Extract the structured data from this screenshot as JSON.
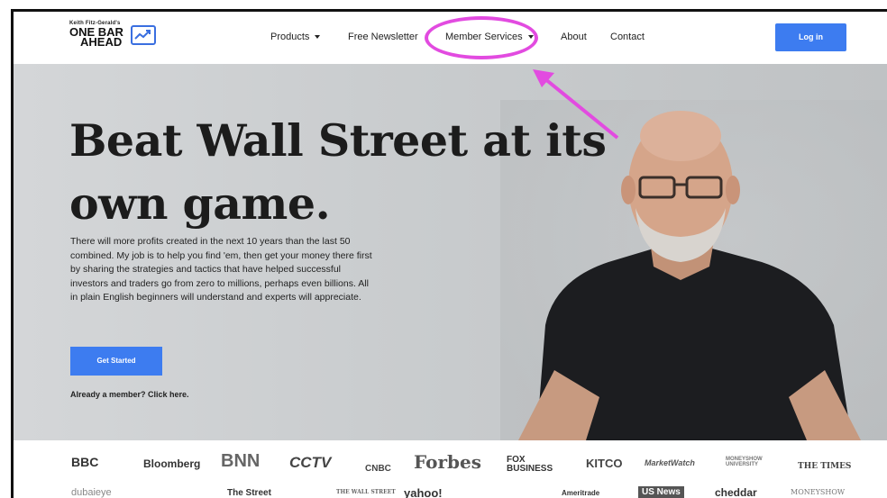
{
  "nav": {
    "logo_small": "Keith Fitz-Gerald's",
    "logo_line1": "ONE BAR",
    "logo_line2": "AHEAD",
    "items": [
      {
        "label": "Products"
      },
      {
        "label": "Free Newsletter"
      },
      {
        "label": "Member Services"
      },
      {
        "label": "About"
      },
      {
        "label": "Contact"
      }
    ],
    "login": "Log in"
  },
  "hero": {
    "headline_1": "Beat Wall Street at its",
    "headline_2": "own game.",
    "paragraph": "There will more profits created in the next 10 years than the last 50 combined. My job is to help you find 'em, then get your money there first by sharing the strategies and tactics that have helped successful investors and traders go from zero to millions, perhaps even billions. All in plain English beginners will understand and experts will appreciate.",
    "cta": "Get Started",
    "member_link": "Already a member? Click here."
  },
  "press_row1": [
    "BBC",
    "Bloomberg",
    "BNN",
    "CCTV",
    "CNBC",
    "Forbes",
    "FOX BUSINESS",
    "KITCO",
    "MarketWatch",
    "MONEYSHOW UNIVERSITY",
    "THE TIMES"
  ],
  "press_row2": [
    "dubaieye",
    "The Street",
    "THE WALL STREET",
    "yahoo!",
    "Ameritrade",
    "US News",
    "cheddar",
    "MONEYSHOW"
  ],
  "colors": {
    "accent": "#3d7cf0",
    "annotation": "#e24be0"
  }
}
